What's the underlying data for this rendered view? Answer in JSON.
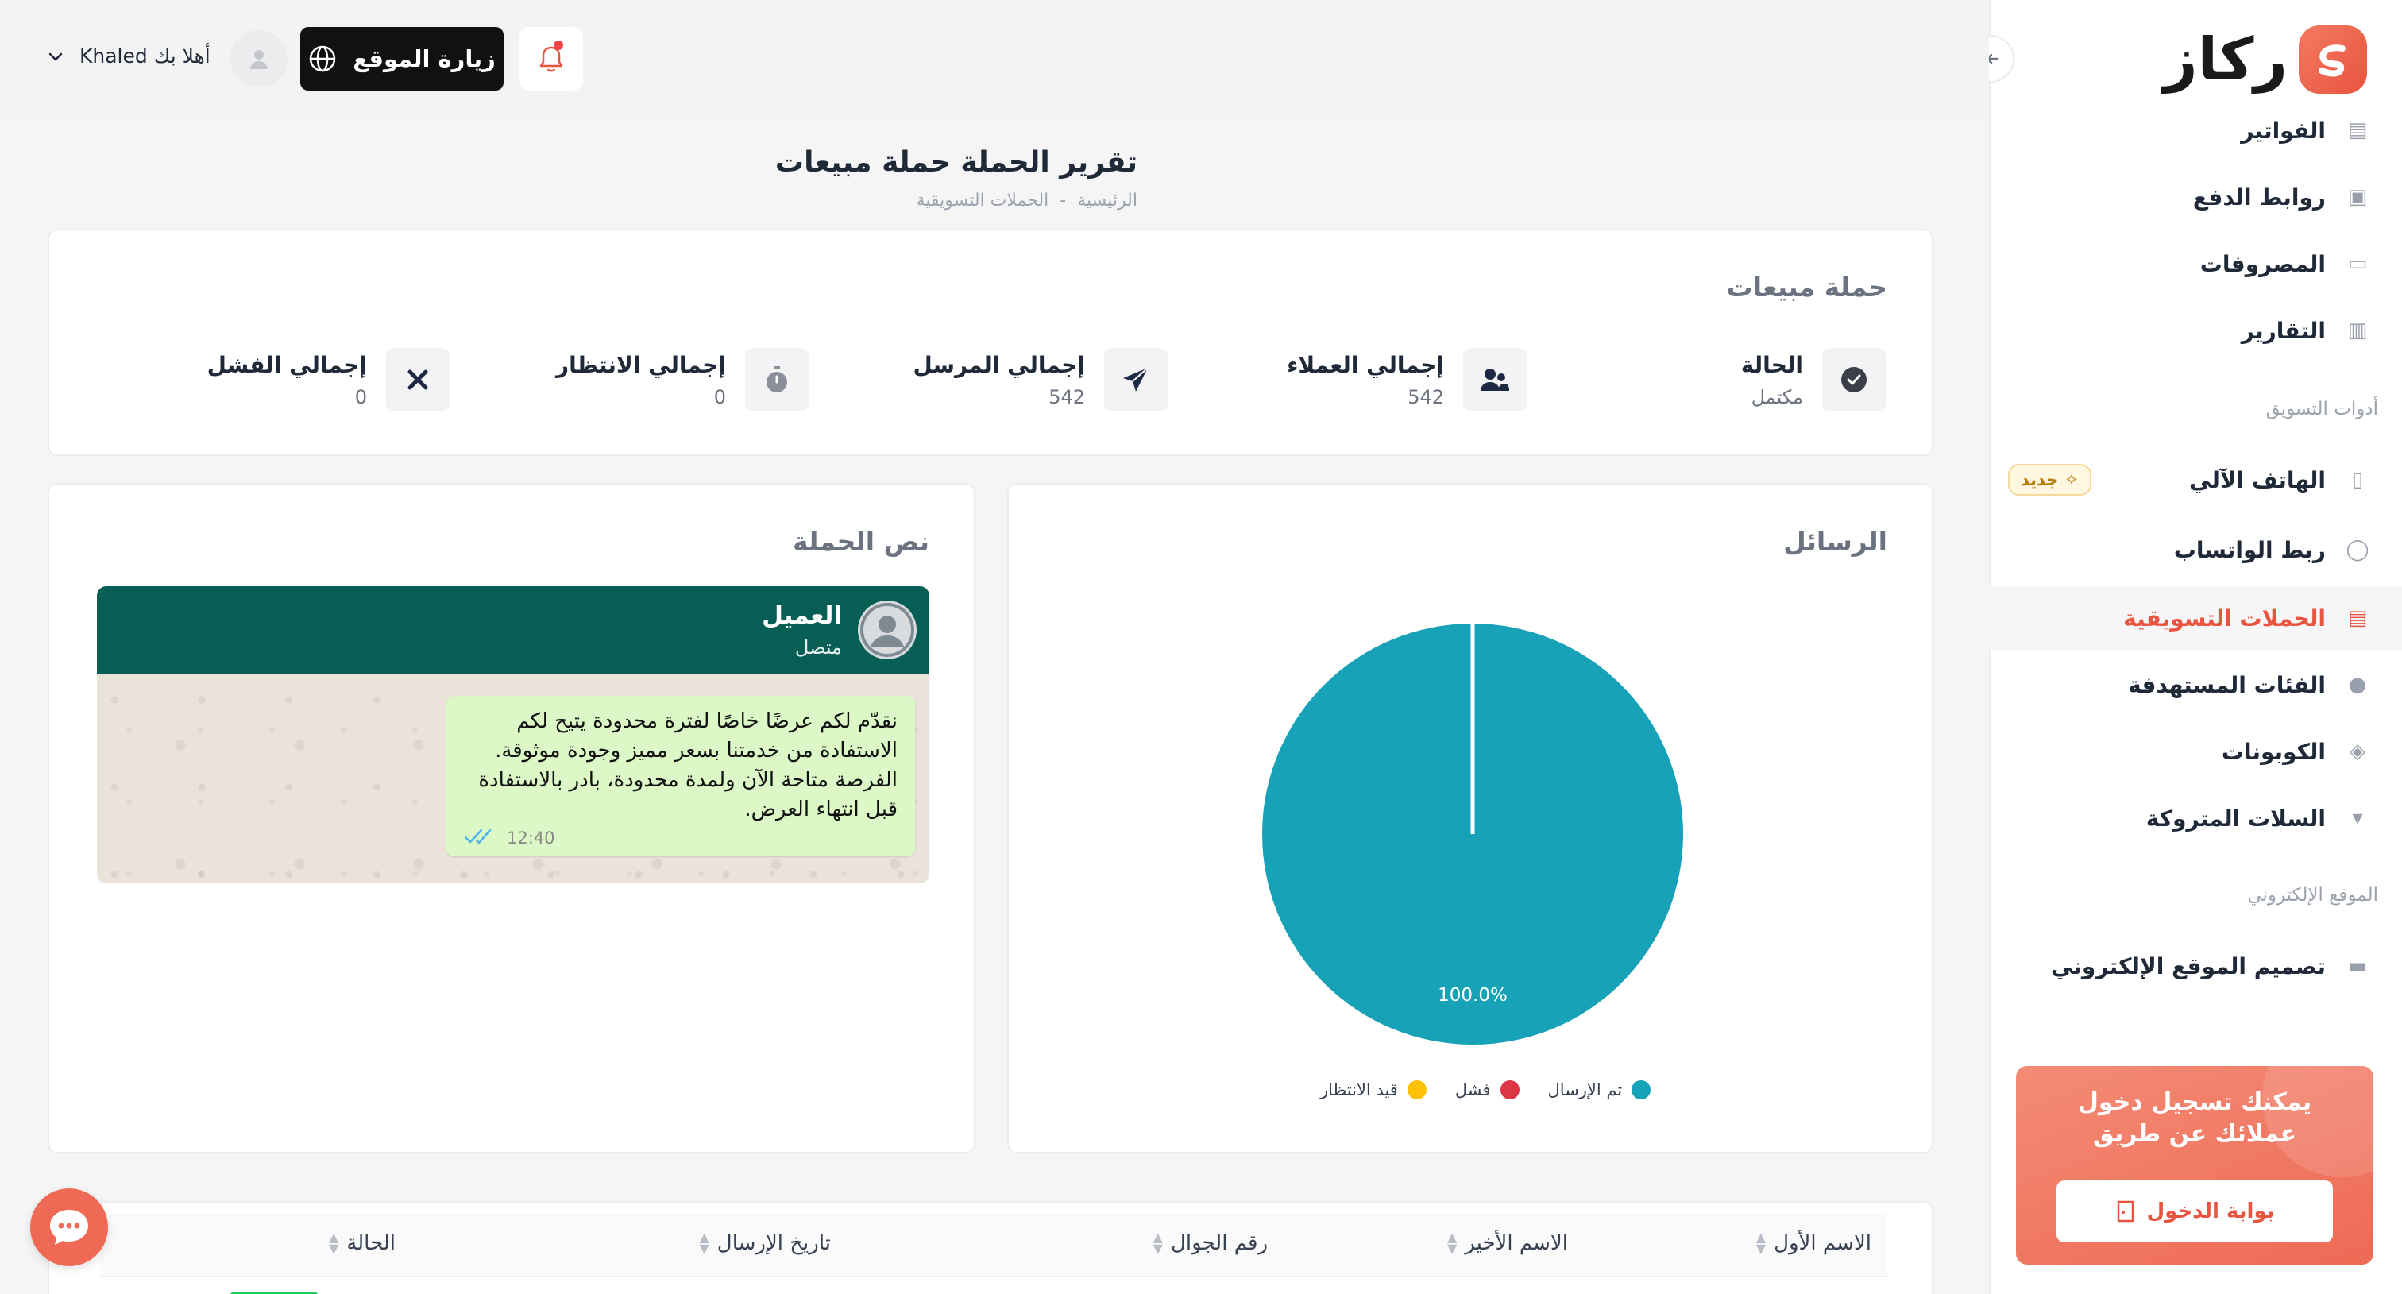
{
  "brand": {
    "name": "ركاز",
    "accent": "#e8543f"
  },
  "sidebar": {
    "items": [
      {
        "label": "الفواتير",
        "icon": "invoice-icon"
      },
      {
        "label": "روابط الدفع",
        "icon": "payment-link-icon"
      },
      {
        "label": "المصروفات",
        "icon": "expenses-icon"
      },
      {
        "label": "التقارير",
        "icon": "reports-icon"
      }
    ],
    "section_marketing": "أدوات التسويق",
    "marketing_items": [
      {
        "label": "الهاتف الآلي",
        "icon": "auto-phone-icon",
        "badge": "جديد"
      },
      {
        "label": "ربط الواتساب",
        "icon": "whatsapp-icon"
      },
      {
        "label": "الحملات التسويقية",
        "icon": "campaign-icon"
      },
      {
        "label": "الفئات المستهدفة",
        "icon": "audience-icon"
      },
      {
        "label": "الكوبونات",
        "icon": "coupon-icon"
      },
      {
        "label": "السلات المتروكة",
        "icon": "cart-icon"
      }
    ],
    "section_website": "الموقع الإلكتروني",
    "website_items": [
      {
        "label": "تصميم الموقع الإلكتروني",
        "icon": "monitor-icon"
      }
    ],
    "promo": {
      "text": "يمكنك تسجيل دخول عملائك عن طريق",
      "button": "بوابة الدخول"
    }
  },
  "topbar": {
    "visit_site": "زيارة الموقع",
    "greeting": "أهلا بك Khaled"
  },
  "page": {
    "title": "تقرير الحملة حملة مبيعات",
    "breadcrumb": [
      "الرئيسية",
      "-",
      "الحملات التسويقية"
    ]
  },
  "summary": {
    "title": "حملة مبيعات",
    "stats": [
      {
        "label": "الحالة",
        "value": "مكتمل",
        "icon": "check-circle-icon"
      },
      {
        "label": "إجمالي العملاء",
        "value": "542",
        "icon": "users-icon"
      },
      {
        "label": "إجمالي المرسل",
        "value": "542",
        "icon": "send-icon"
      },
      {
        "label": "إجمالي الانتظار",
        "value": "0",
        "icon": "stopwatch-icon"
      },
      {
        "label": "إجمالي الفشل",
        "value": "0",
        "icon": "x-icon"
      }
    ]
  },
  "messages_card": {
    "title": "الرسائل"
  },
  "campaign_text_card": {
    "title": "نص الحملة",
    "contact_name": "العميل",
    "contact_status": "متصل",
    "message": "نقدّم لكم عرضًا خاصًا لفترة محدودة يتيح لكم الاستفادة من خدمتنا بسعر مميز وجودة موثوقة. الفرصة متاحة الآن ولمدة محدودة، بادر بالاستفادة قبل انتهاء العرض.",
    "time": "12:40"
  },
  "chart_data": {
    "type": "pie",
    "categories": [
      "تم الإرسال",
      "فشل",
      "قيد الانتظار"
    ],
    "values": [
      542,
      0,
      0
    ],
    "colors": [
      "#17a2b8",
      "#dc3545",
      "#ffc107"
    ],
    "data_labels": [
      "100.0%"
    ],
    "legend_position": "bottom"
  },
  "table": {
    "columns": [
      "الاسم الأول",
      "الاسم الأخير",
      "رقم الجوال",
      "تاريخ الإرسال",
      "الحالة"
    ]
  }
}
